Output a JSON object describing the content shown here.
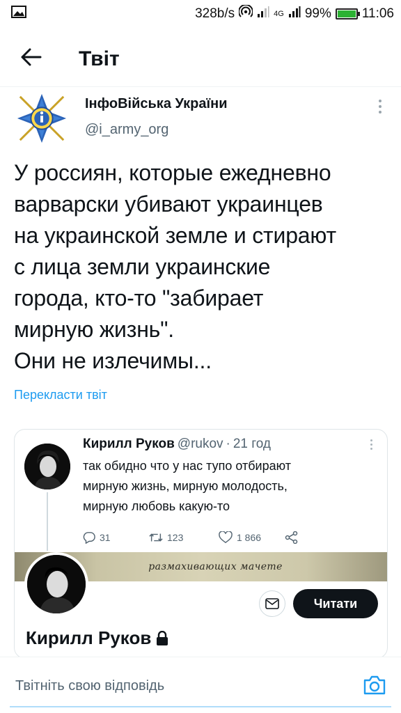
{
  "status_bar": {
    "speed": "328b/s",
    "network": "4G",
    "battery": "99%",
    "battery_level": 0.99,
    "time": "11:06",
    "icons": [
      "gallery-icon",
      "hotspot-icon",
      "signal-icon",
      "wifi-icon",
      "battery-icon"
    ]
  },
  "header": {
    "title": "Твіт",
    "back_icon": "arrow-left-icon"
  },
  "tweet": {
    "author_name": "ІнфоВійська України",
    "author_handle": "@i_army_org",
    "text": "У россиян, которые ежедневно\nварварски убивают украинцев\nна украинской земле и стирают\nс лица земли украинские\nгорода, кто-то \"забирает\nмирную жизнь\".\nОни не излечимы...",
    "translate_link": "Перекласти твіт"
  },
  "quote": {
    "author_name": "Кирилл Руков",
    "author_handle": "@rukov",
    "separator": "·",
    "time": "21 год",
    "text": "так обидно что у нас тупо отбирают\nмирную жизнь, мирную молодость,\nмирную любовь какую-то",
    "reply_count": "31",
    "retweet_count": "123",
    "like_count": "1 866",
    "banner_text": "размахивающих мачете",
    "read_button": "Читати",
    "profile_name": "Кирилл Руков"
  },
  "reply_bar": {
    "placeholder": "Твітніть свою відповідь"
  },
  "colors": {
    "accent": "#1d9bf0",
    "text": "#0f1419",
    "secondary": "#536471",
    "battery": "#2cb233"
  }
}
